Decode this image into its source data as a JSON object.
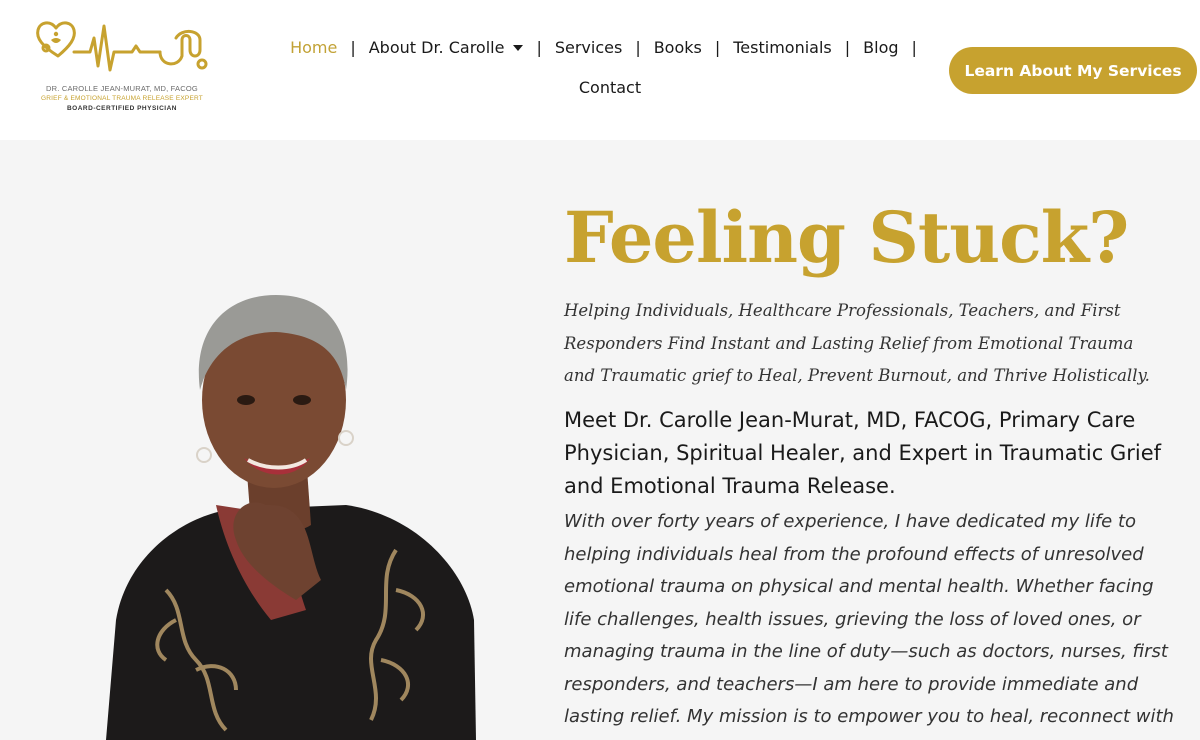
{
  "brand": {
    "line1": "DR. CAROLLE JEAN-MURAT, MD, FACOG",
    "line2": "GRIEF & EMOTIONAL TRAUMA RELEASE EXPERT",
    "line3": "BOARD-CERTIFIED PHYSICIAN",
    "gold": "#c7a22f"
  },
  "nav": {
    "items": [
      {
        "label": "Home",
        "active": true
      },
      {
        "label": "About Dr. Carolle",
        "has_dropdown": true
      },
      {
        "label": "Services"
      },
      {
        "label": "Books"
      },
      {
        "label": "Testimonials"
      },
      {
        "label": "Blog"
      },
      {
        "label": "Contact"
      }
    ],
    "separator": "|"
  },
  "cta": {
    "label": "Learn About My Services"
  },
  "hero": {
    "title": "Feeling Stuck?",
    "subtitle": "Helping Individuals, Healthcare Professionals, Teachers, and First Responders Find Instant and Lasting Relief from Emotional Trauma and Traumatic grief to Heal, Prevent Burnout, and Thrive Holistically.",
    "meet": "Meet Dr. Carolle Jean-Murat, MD, FACOG, Primary Care Physician, Spiritual Healer, and Expert in Traumatic Grief and Emotional Trauma Release.",
    "body": "With over forty years of experience, I have dedicated my life to helping individuals heal from the profound effects of unresolved emotional trauma on physical and mental health. Whether facing life challenges, health issues, grieving the loss of loved ones, or managing trauma in the line of duty—such as doctors, nurses, first responders, and teachers—I am here to provide immediate and lasting relief. My mission is to empower you to heal, reconnect with"
  }
}
